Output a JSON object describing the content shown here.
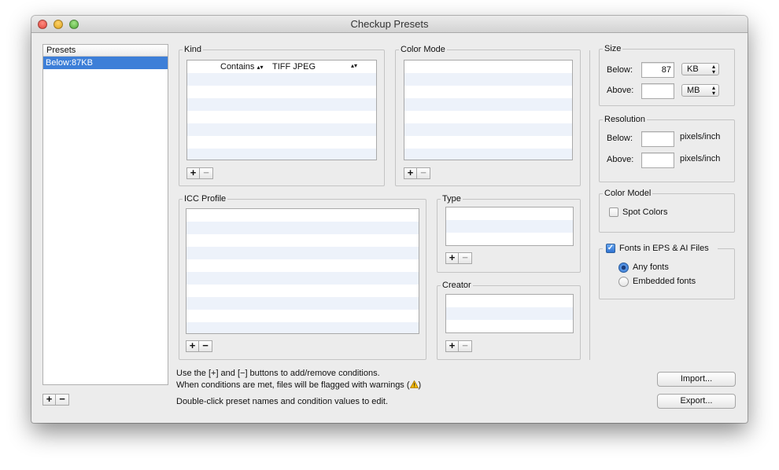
{
  "window": {
    "title": "Checkup Presets"
  },
  "presets": {
    "header": "Presets",
    "items": [
      "Below:87KB"
    ]
  },
  "kind": {
    "label": "Kind",
    "rows": [
      {
        "operator": "Contains",
        "value": "TIFF JPEG"
      }
    ]
  },
  "color_mode": {
    "label": "Color Mode"
  },
  "icc_profile": {
    "label": "ICC Profile"
  },
  "type": {
    "label": "Type"
  },
  "creator": {
    "label": "Creator"
  },
  "size": {
    "label": "Size",
    "below_label": "Below:",
    "below_value": "87",
    "below_unit": "KB",
    "above_label": "Above:",
    "above_value": "",
    "above_unit": "MB"
  },
  "resolution": {
    "label": "Resolution",
    "below_label": "Below:",
    "below_unit": "pixels/inch",
    "above_label": "Above:",
    "above_unit": "pixels/inch"
  },
  "color_model": {
    "label": "Color Model",
    "spot_colors": "Spot Colors",
    "spot_colors_checked": false
  },
  "fonts": {
    "label": "Fonts in EPS & AI Files",
    "checked": true,
    "any": "Any fonts",
    "embedded": "Embedded fonts",
    "selected": "any"
  },
  "help": {
    "line1": "Use the [+] and [−] buttons to add/remove conditions.",
    "line2": "When conditions are met, files will be flagged with warnings (",
    "line2_end": ")",
    "line3": "Double-click preset names and condition values to edit."
  },
  "buttons": {
    "import": "Import...",
    "export": "Export..."
  },
  "controls": {
    "plus": "+",
    "minus": "−"
  },
  "colors": {
    "selection": "#3d7fd8",
    "warning": "#f2b705"
  }
}
